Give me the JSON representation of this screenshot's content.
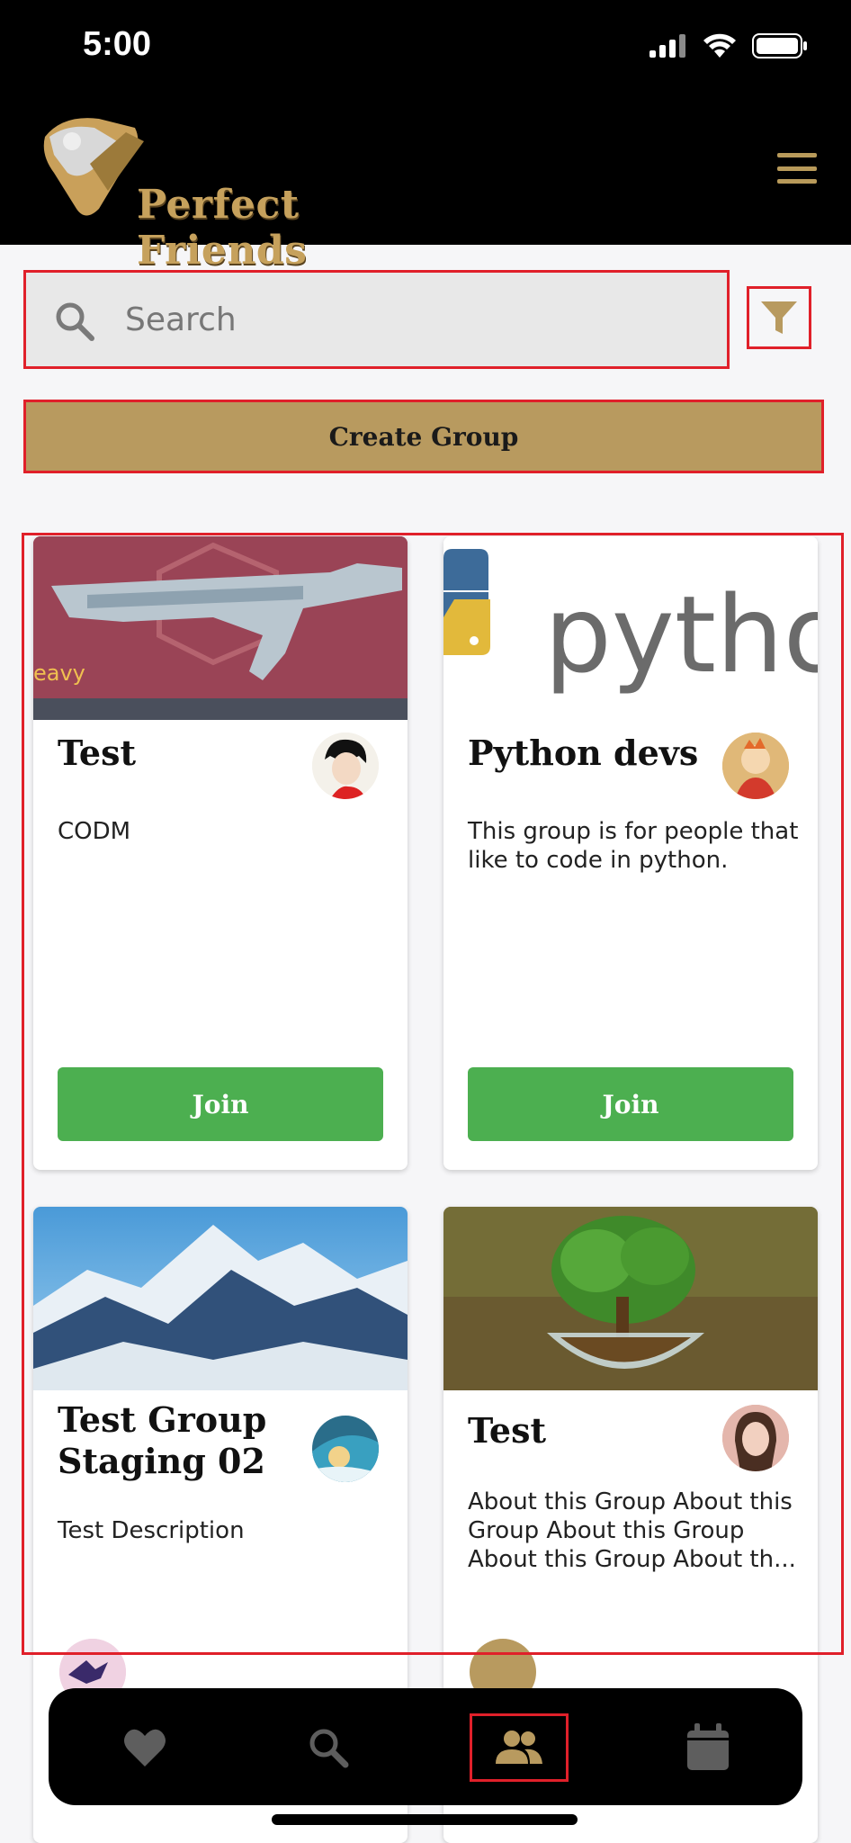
{
  "status_bar": {
    "time": "5:00"
  },
  "header": {
    "app_name": "Perfect Friends"
  },
  "search": {
    "placeholder": "Search"
  },
  "actions": {
    "create_group_label": "Create Group"
  },
  "groups": [
    {
      "title": "Test",
      "description": "CODM",
      "join_label": "Join",
      "image": "rifle-image"
    },
    {
      "title": "Python devs",
      "description": "This group is for people that like to code in python.",
      "join_label": "Join",
      "image": "python-logo-image",
      "image_text": "python"
    },
    {
      "title": "Test Group Staging 02",
      "description": "Test Description",
      "image": "mountain-image"
    },
    {
      "title": "Test",
      "description": "About this Group About this Group About this Group About this Group About th...",
      "image": "tree-image"
    }
  ],
  "nav": {
    "items": [
      "heart-icon",
      "search-icon",
      "groups-icon",
      "calendar-icon"
    ],
    "active": "groups-icon"
  },
  "colors": {
    "accent": "#b89a5f",
    "join": "#4caf50",
    "highlight": "#e0202a"
  }
}
